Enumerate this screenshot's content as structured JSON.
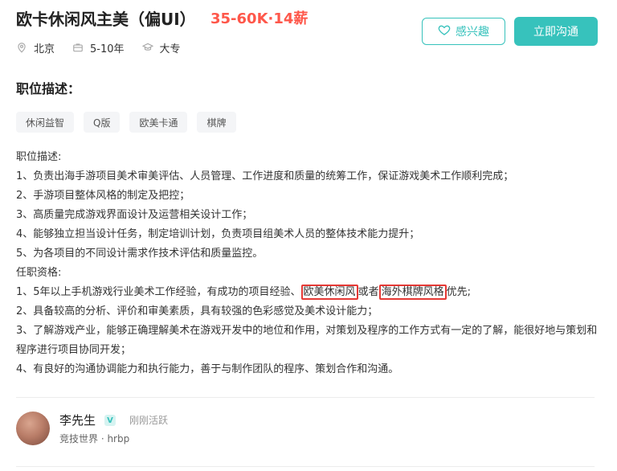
{
  "job": {
    "title": "欧卡休闲风主美（偏UI）",
    "salary": "35-60K·14薪",
    "location": "北京",
    "experience": "5-10年",
    "education": "大专"
  },
  "actions": {
    "interest_label": "感兴趣",
    "chat_label": "立即沟通"
  },
  "section": {
    "title": "职位描述："
  },
  "tags": [
    "休闲益智",
    "Q版",
    "欧美卡通",
    "棋牌"
  ],
  "description": {
    "heading1": "职位描述:",
    "lines1": [
      "1、负责出海手游项目美术审美评估、人员管理、工作进度和质量的统筹工作，保证游戏美术工作顺利完成；",
      "2、手游项目整体风格的制定及把控；",
      "3、高质量完成游戏界面设计及运营相关设计工作；",
      "4、能够独立担当设计任务，制定培训计划，负责项目组美术人员的整体技术能力提升；",
      "5、为各项目的不同设计需求作技术评估和质量监控。"
    ],
    "heading2": "任职资格:",
    "req1_prefix": "1、5年以上手机游戏行业美术工作经验，有成功的项目经验、",
    "req1_hl1": "欧美休闲风",
    "req1_mid": "或者",
    "req1_hl2": "海外棋牌风格",
    "req1_suffix": "优先;",
    "req2": "2、具备较高的分析、评价和审美素质，具有较强的色彩感觉及美术设计能力；",
    "req3": "3、了解游戏产业，能够正确理解美术在游戏开发中的地位和作用，对策划及程序的工作方式有一定的了解，能很好地与策划和程序进行项目协同开发；",
    "req4": "4、有良好的沟通协调能力和执行能力，善于与制作团队的程序、策划合作和沟通。"
  },
  "recruiter": {
    "name": "李先生",
    "badge": "V",
    "status": "刚刚活跃",
    "company": "竞技世界 · hrbp"
  },
  "colors": {
    "accent": "#37c2bc",
    "salary": "#fe574a",
    "highlight_box": "#e53935"
  }
}
